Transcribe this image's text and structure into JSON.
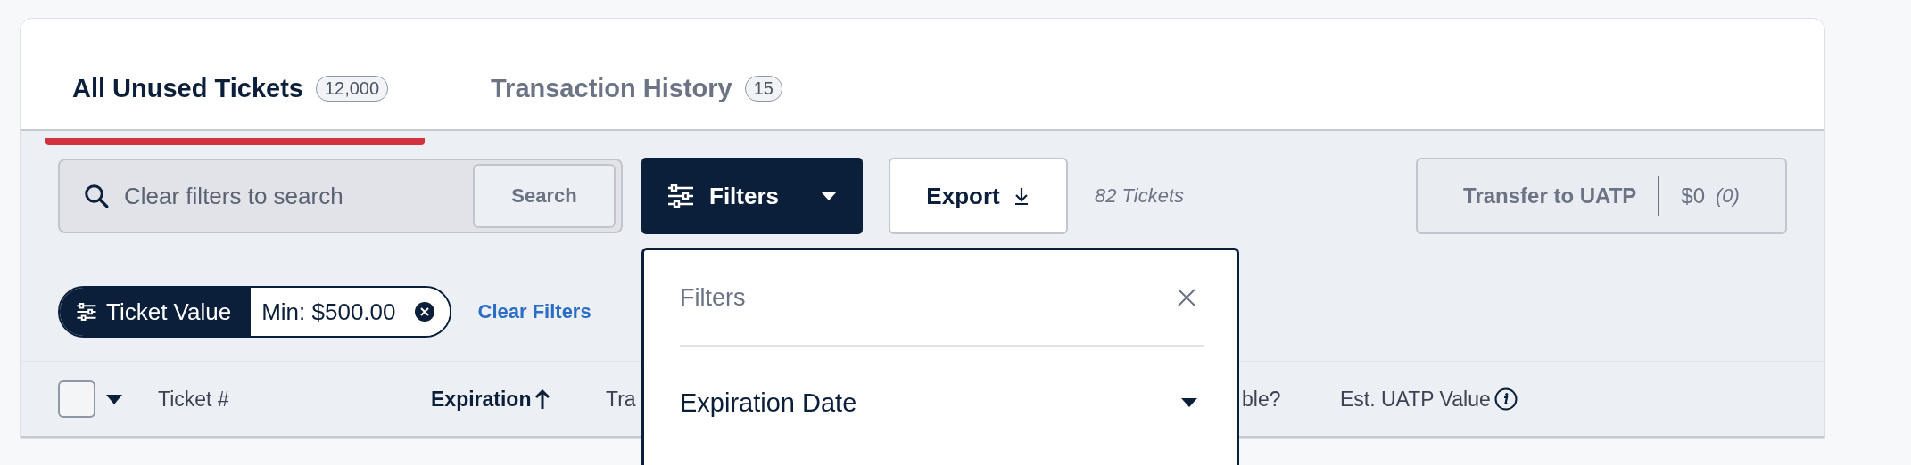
{
  "tabs": [
    {
      "label": "All Unused Tickets",
      "count": "12,000",
      "selected": true
    },
    {
      "label": "Transaction History",
      "count": "15",
      "selected": false
    }
  ],
  "toolbar": {
    "search": {
      "placeholder": "Clear filters to search",
      "button": "Search"
    },
    "filters_button": "Filters",
    "export_button": "Export",
    "ticket_count": "82 Tickets",
    "transfer": {
      "label": "Transfer to UATP",
      "amount": "$0",
      "count": "(0)"
    }
  },
  "active_filters": [
    {
      "label": "Ticket Value",
      "value": "Min: $500.00"
    }
  ],
  "clear_filters": "Clear Filters",
  "table": {
    "select_all": {
      "checked": false
    },
    "columns": [
      {
        "label": "Ticket #",
        "kind": "plain"
      },
      {
        "label": "Expiration",
        "kind": "sorted"
      },
      {
        "label": "Tra",
        "kind": "plain"
      },
      {
        "label": "ble?",
        "kind": "plain"
      },
      {
        "label": "Est. UATP Value",
        "kind": "info"
      }
    ]
  },
  "filters_panel": {
    "title": "Filters",
    "sections": [
      {
        "label": "Expiration Date",
        "expanded": false
      }
    ]
  }
}
